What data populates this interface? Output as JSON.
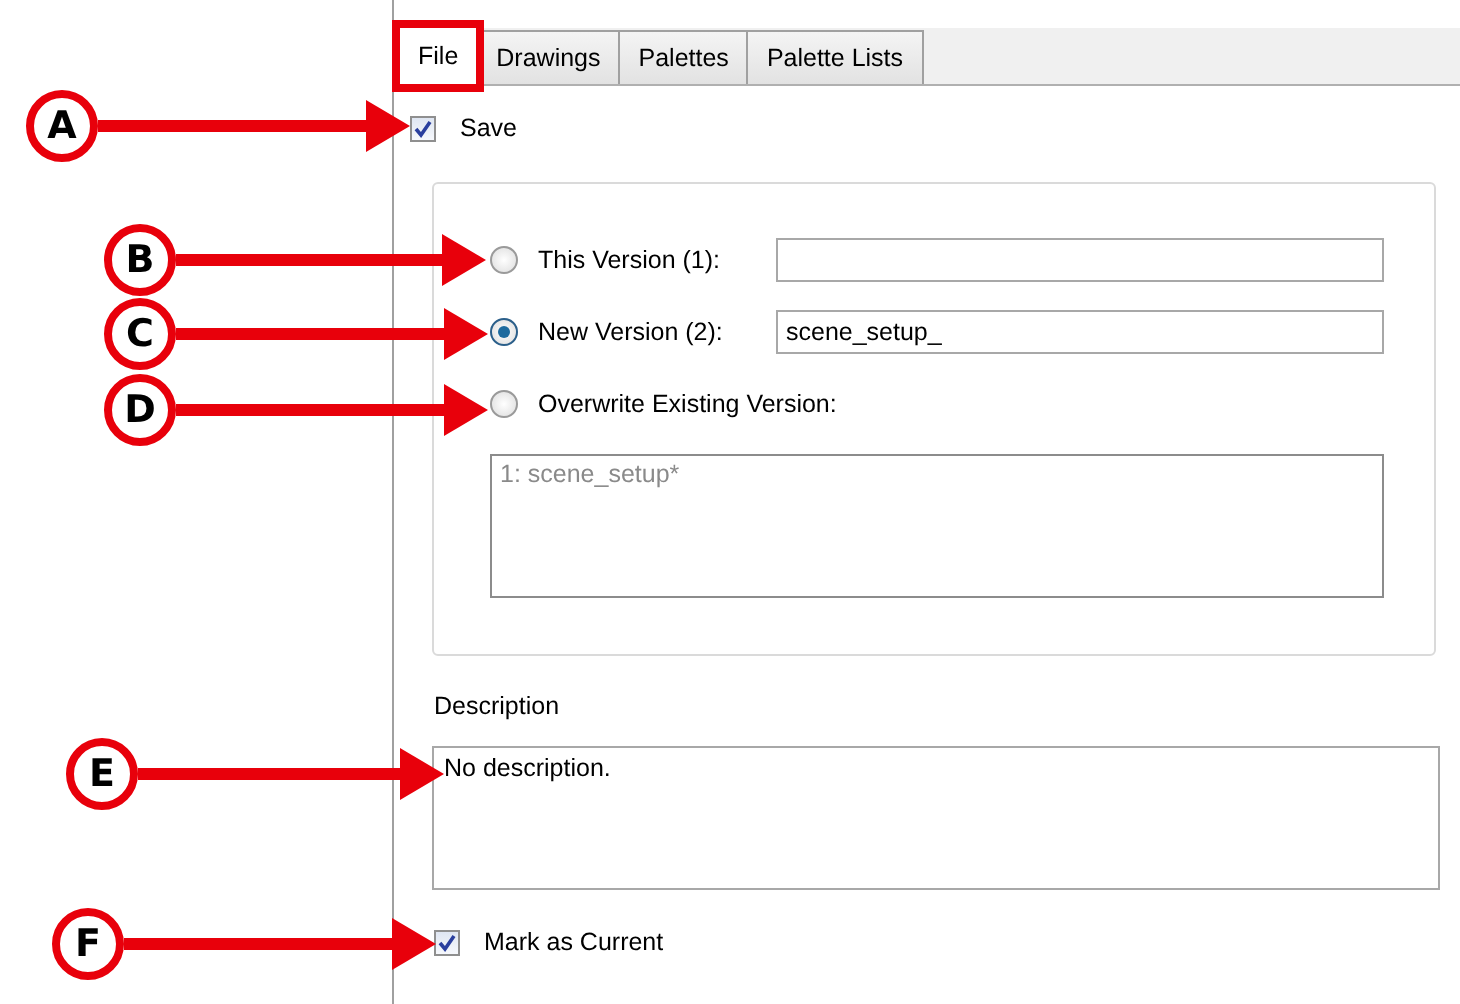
{
  "tabs": [
    {
      "label": "File",
      "selected": true,
      "highlighted": true
    },
    {
      "label": "Drawings",
      "selected": false,
      "highlighted": false
    },
    {
      "label": "Palettes",
      "selected": false,
      "highlighted": false
    },
    {
      "label": "Palette Lists",
      "selected": false,
      "highlighted": false
    }
  ],
  "save": {
    "label": "Save",
    "checked": true
  },
  "versions": [
    {
      "label": "This Version (1):",
      "selected": false,
      "kind": "field"
    },
    {
      "label": "New Version (2):",
      "selected": true,
      "kind": "field",
      "value": "scene_setup_"
    },
    {
      "label": "Overwrite Existing Version:",
      "selected": false,
      "kind": "plain"
    }
  ],
  "existing_versions": [
    "1: scene_setup*"
  ],
  "description": {
    "label": "Description",
    "value": "No description."
  },
  "mark_as_current": {
    "label": "Mark as Current",
    "checked": true
  },
  "callouts": [
    {
      "label": "A"
    },
    {
      "label": "B"
    },
    {
      "label": "C"
    },
    {
      "label": "D"
    },
    {
      "label": "E"
    },
    {
      "label": "F"
    }
  ]
}
